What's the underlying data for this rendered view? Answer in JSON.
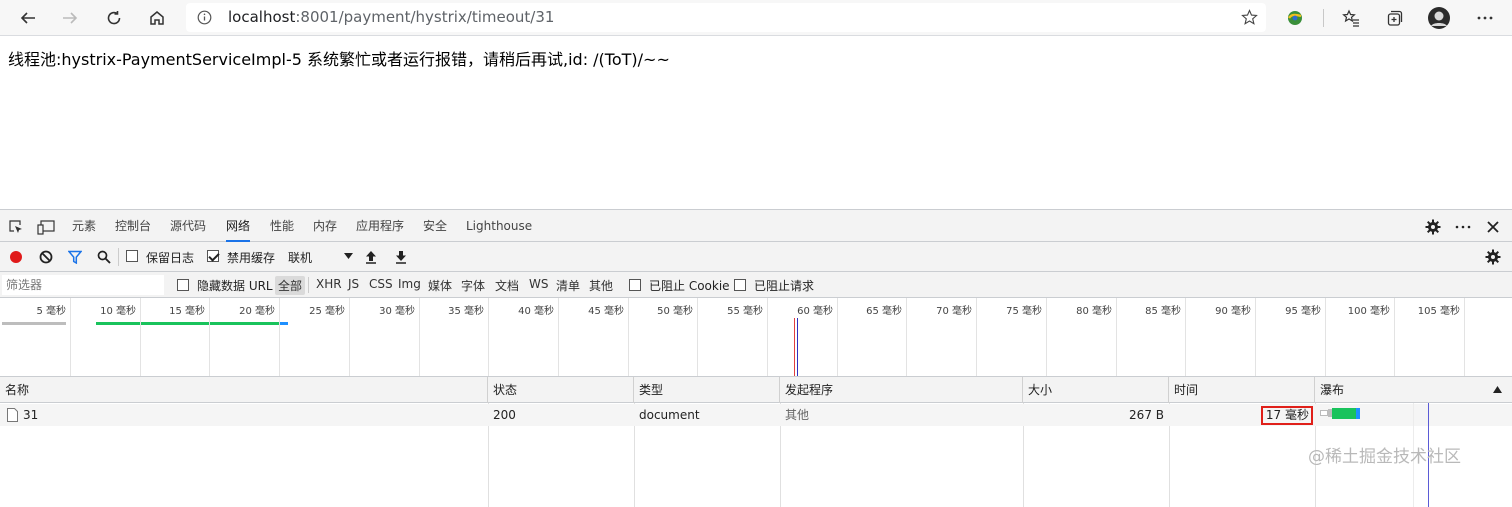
{
  "browser": {
    "url_host": "localhost",
    "url_path": ":8001/payment/hystrix/timeout/31",
    "icons": [
      "back-icon",
      "forward-icon",
      "refresh-icon",
      "home-icon",
      "info-icon",
      "favorite-star-icon",
      "extension-icon",
      "favorites-icon",
      "collections-icon",
      "avatar",
      "more-icon"
    ]
  },
  "page": {
    "message": "线程池:hystrix-PaymentServiceImpl-5  系统繁忙或者运行报错，请稍后再试,id:  /(ToT)/~~"
  },
  "devtools": {
    "tabs": [
      "元素",
      "控制台",
      "源代码",
      "网络",
      "性能",
      "内存",
      "应用程序",
      "安全",
      "Lighthouse"
    ],
    "active_tab": "网络",
    "net_toolbar": {
      "preserve_log": "保留日志",
      "disable_cache": "禁用缓存",
      "throttling": "联机"
    },
    "filter": {
      "placeholder": "筛选器",
      "hide_data_urls": "隐藏数据 URL",
      "types": [
        "全部",
        "XHR",
        "JS",
        "CSS",
        "Img",
        "媒体",
        "字体",
        "文档",
        "WS",
        "清单",
        "其他"
      ],
      "blocked_cookies": "已阻止 Cookie",
      "blocked_requests": "已阻止请求"
    },
    "overview_ticks": [
      "5 毫秒",
      "10 毫秒",
      "15 毫秒",
      "20 毫秒",
      "25 毫秒",
      "30 毫秒",
      "35 毫秒",
      "40 毫秒",
      "45 毫秒",
      "50 毫秒",
      "55 毫秒",
      "60 毫秒",
      "65 毫秒",
      "70 毫秒",
      "75 毫秒",
      "80 毫秒",
      "85 毫秒",
      "90 毫秒",
      "95 毫秒",
      "100 毫秒",
      "105 毫秒",
      "110"
    ],
    "columns": {
      "name": "名称",
      "status": "状态",
      "type": "类型",
      "initiator": "发起程序",
      "size": "大小",
      "time": "时间",
      "waterfall": "瀑布"
    },
    "requests": [
      {
        "name": "31",
        "status": "200",
        "type": "document",
        "initiator": "其他",
        "size": "267 B",
        "time": "17 毫秒"
      }
    ]
  },
  "watermark": "@稀土掘金技术社区"
}
